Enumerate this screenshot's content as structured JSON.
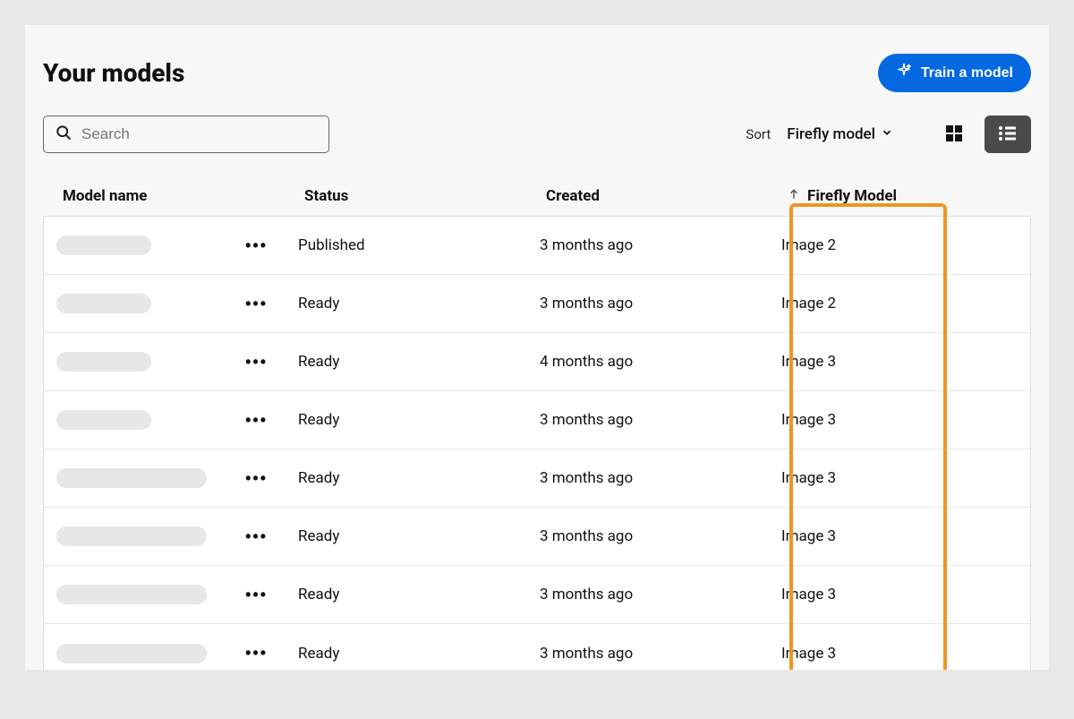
{
  "header": {
    "title": "Your models",
    "train_button": "Train a model"
  },
  "search": {
    "placeholder": "Search"
  },
  "sort": {
    "label": "Sort",
    "value": "Firefly model"
  },
  "columns": {
    "name": "Model name",
    "status": "Status",
    "created": "Created",
    "model": "Firefly Model"
  },
  "rows": [
    {
      "status": "Published",
      "created": "3 months ago",
      "model": "Image 2",
      "name_width": "w1"
    },
    {
      "status": "Ready",
      "created": "3 months ago",
      "model": "Image 2",
      "name_width": "w1"
    },
    {
      "status": "Ready",
      "created": "4 months ago",
      "model": "Image 3",
      "name_width": "w1"
    },
    {
      "status": "Ready",
      "created": "3 months ago",
      "model": "Image 3",
      "name_width": "w1"
    },
    {
      "status": "Ready",
      "created": "3 months ago",
      "model": "Image 3",
      "name_width": "w2"
    },
    {
      "status": "Ready",
      "created": "3 months ago",
      "model": "Image 3",
      "name_width": "w2"
    },
    {
      "status": "Ready",
      "created": "3 months ago",
      "model": "Image 3",
      "name_width": "w2"
    },
    {
      "status": "Ready",
      "created": "3 months ago",
      "model": "Image 3",
      "name_width": "w2"
    }
  ],
  "active_view": "list"
}
